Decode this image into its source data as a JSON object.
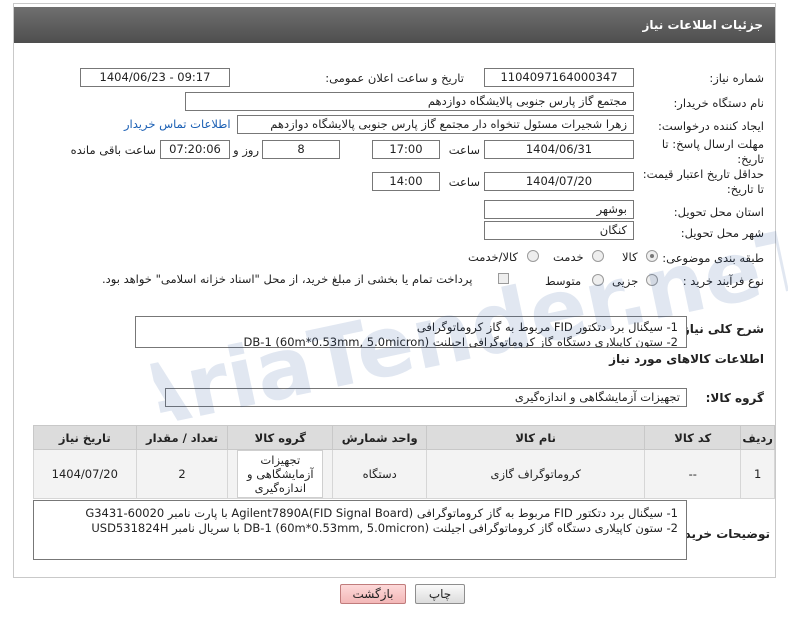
{
  "header": {
    "title": "جزئیات اطلاعات نیاز"
  },
  "form": {
    "need_number_label": "شماره نیاز:",
    "need_number": "1104097164000347",
    "announce_label": "تاریخ و ساعت اعلان عمومی:",
    "announce_value": "1404/06/23 - 09:17",
    "buyer_org_label": "نام دستگاه خریدار:",
    "buyer_org": "مجتمع گاز پارس جنوبی  پالایشگاه دوازدهم",
    "creator_label": "ایجاد کننده درخواست:",
    "creator": "زهرا شجیرات مسئول تنخواه دار مجتمع گاز پارس جنوبی  پالایشگاه دوازدهم",
    "contact_link": "اطلاعات تماس خریدار",
    "deadline_label_1": "مهلت ارسال پاسخ: تا",
    "deadline_label_2": "تاریخ:",
    "deadline_date": "1404/06/31",
    "time_label": "ساعت",
    "deadline_time": "17:00",
    "days_value": "8",
    "days_label": "روز و",
    "remaining_time": "07:20:06",
    "remaining_label": "ساعت باقی مانده",
    "min_valid_label_1": "حداقل تاریخ اعتبار قیمت:",
    "min_valid_label_2": "تا تاریخ:",
    "valid_date": "1404/07/20",
    "valid_time_label": "ساعت",
    "valid_time": "14:00",
    "province_label": "استان محل تحویل:",
    "province": "بوشهر",
    "city_label": "شهر محل تحویل:",
    "city": "کنگان",
    "category_label": "طبقه بندی موضوعی:",
    "category_options": [
      "کالا",
      "خدمت",
      "کالا/خدمت"
    ],
    "category_selected": "کالا",
    "process_label": "نوع فرآیند خرید :",
    "process_options": [
      "جزیی",
      "متوسط"
    ],
    "payment_note": "پرداخت تمام یا بخشی از مبلغ خرید، از محل \"اسناد خزانه اسلامی\" خواهد بود."
  },
  "summary": {
    "label": "شرح کلی نیاز:",
    "lines": [
      "1-    سیگنال برد دتکتور FID مربوط به گاز کروماتوگرافی",
      "2-    ستون کاپیلاری دستگاه گاز کروماتوگرافی  اجیلنت DB-1 (60m*0.53mm, 5.0micron)"
    ]
  },
  "goods_info": {
    "title": "اطلاعات کالاهای مورد نیاز",
    "group_label": "گروه کالا:",
    "group_value": "تجهیزات آزمایشگاهی و اندازه‌گیری"
  },
  "table": {
    "headers": [
      "ردیف",
      "کد کالا",
      "نام کالا",
      "واحد شمارش",
      "گروه کالا",
      "تعداد / مقدار",
      "تاریخ نیاز"
    ],
    "rows": [
      {
        "row": "1",
        "code": "--",
        "name": "کروماتوگراف گازی",
        "unit": "دستگاه",
        "group": "تجهیزات آزمایشگاهی و اندازه‌گیری",
        "qty": "2",
        "date": "1404/07/20"
      }
    ]
  },
  "buyer_notes": {
    "label": "توضیحات خریدار:",
    "lines": [
      "1-    سیگنال برد دتکتور FID مربوط به گاز کروماتوگرافی Agilent7890A(FID Signal Board) با پارت نامبر G3431-60020",
      "2-    ستون کاپیلاری دستگاه گاز کروماتوگرافی  اجیلنت DB-1 (60m*0.53mm, 5.0micron) با سریال نامبر USD531824H"
    ]
  },
  "buttons": {
    "print": "چاپ",
    "back": "بازگشت"
  },
  "watermark": {
    "text": "AriaTender.neT"
  }
}
